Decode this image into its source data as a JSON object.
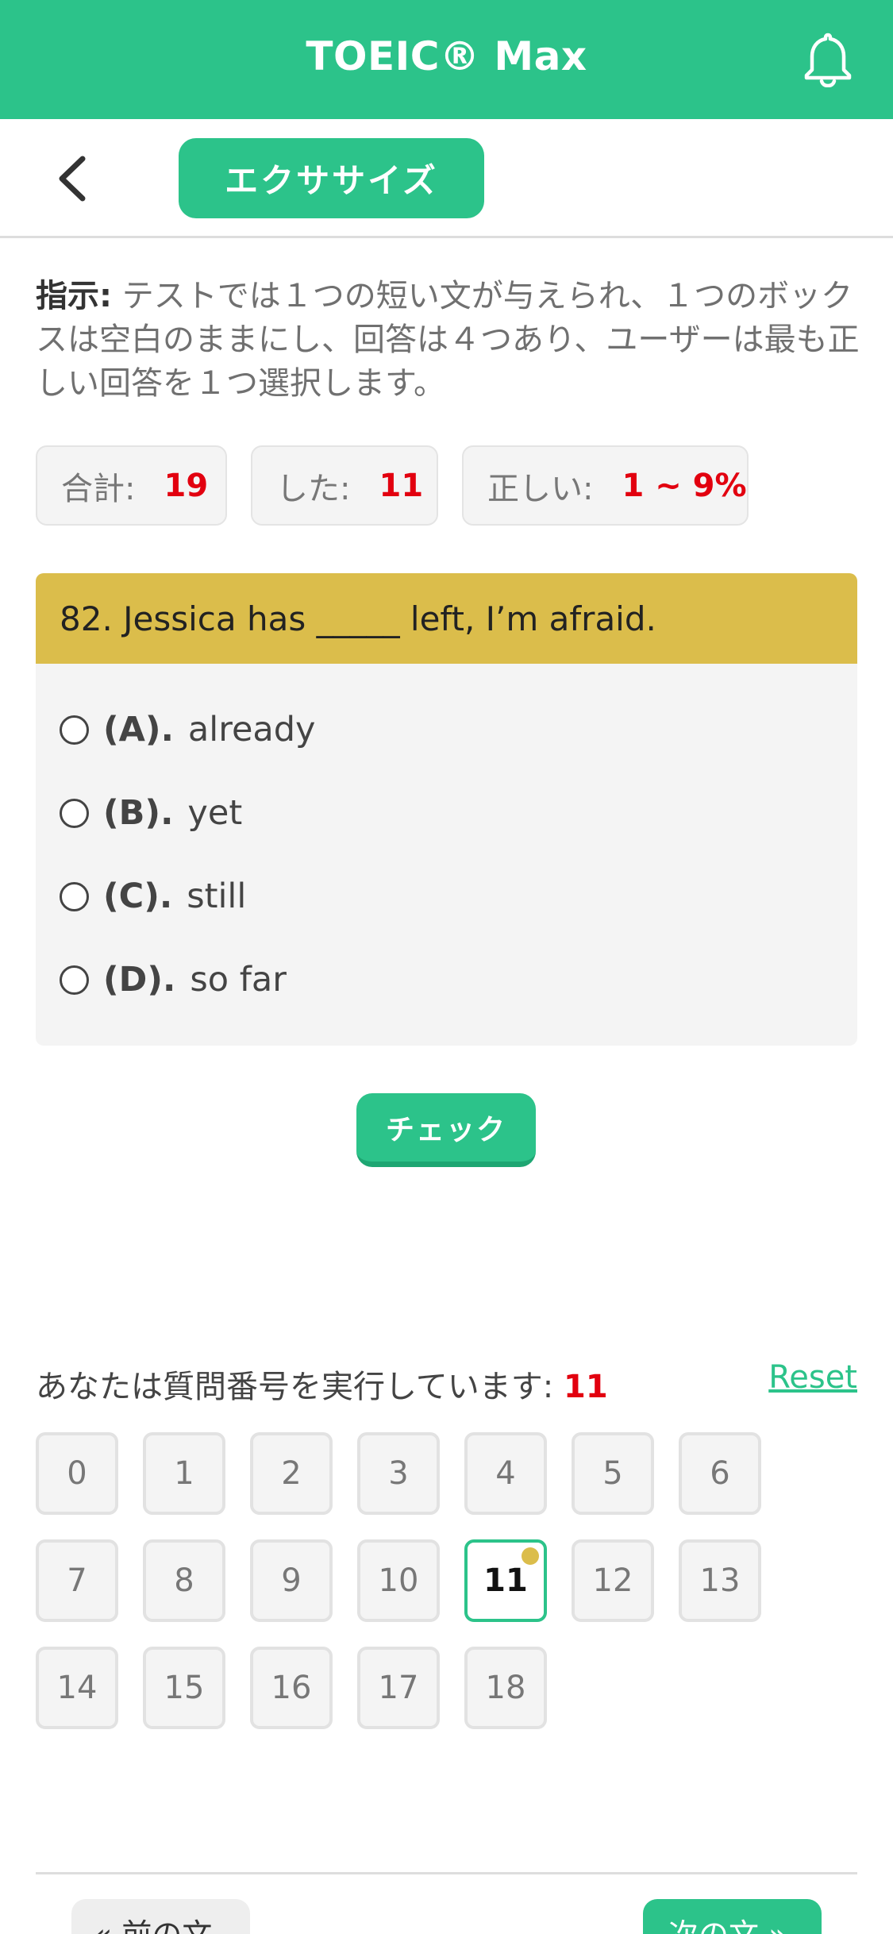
{
  "appbar": {
    "title": "TOEIC® Max"
  },
  "subbar": {
    "mode_label": "エクササイズ"
  },
  "instructions": {
    "label": "指示:",
    "text": " テストでは１つの短い文が与えられ、１つのボックスは空白のままにし、回答は４つあり、ユーザーは最も正しい回答を１つ選択します。"
  },
  "stats": [
    {
      "label": "合計:",
      "value": "19"
    },
    {
      "label": "した:",
      "value": "11"
    },
    {
      "label": "正しい:",
      "value": "1 ~ 9%"
    }
  ],
  "question": {
    "text": "82. Jessica has _____ left, I’m afraid.",
    "options": [
      {
        "letter": "(A).",
        "text": "already"
      },
      {
        "letter": "(B).",
        "text": "yet"
      },
      {
        "letter": "(C).",
        "text": "still"
      },
      {
        "letter": "(D).",
        "text": "so far"
      }
    ]
  },
  "check_label": "チェック",
  "progress": {
    "running_label": "あなたは質問番号を実行しています:",
    "current": "11",
    "reset_label": "Reset",
    "numbers": [
      "0",
      "1",
      "2",
      "3",
      "4",
      "5",
      "6",
      "7",
      "8",
      "9",
      "10",
      "11",
      "12",
      "13",
      "14",
      "15",
      "16",
      "17",
      "18"
    ]
  },
  "nav": {
    "prev_label": "« 前の文",
    "next_label": "次の文 »"
  },
  "colors": {
    "primary": "#2cc38a",
    "accent_yellow": "#dbbd4b",
    "highlight_red": "#e2000f"
  }
}
